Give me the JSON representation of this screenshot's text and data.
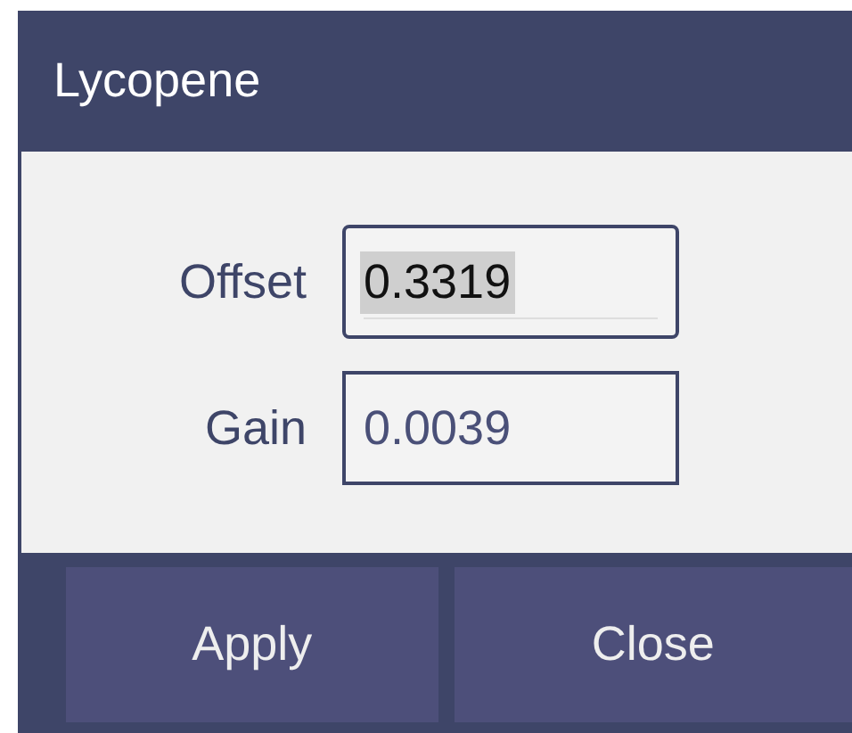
{
  "dialog": {
    "title": "Lycopene"
  },
  "fields": [
    {
      "label": "Offset",
      "value": "0.3319",
      "focused": true
    },
    {
      "label": "Gain",
      "value": "0.0039",
      "focused": false
    }
  ],
  "buttons": [
    "Apply",
    "Close"
  ]
}
